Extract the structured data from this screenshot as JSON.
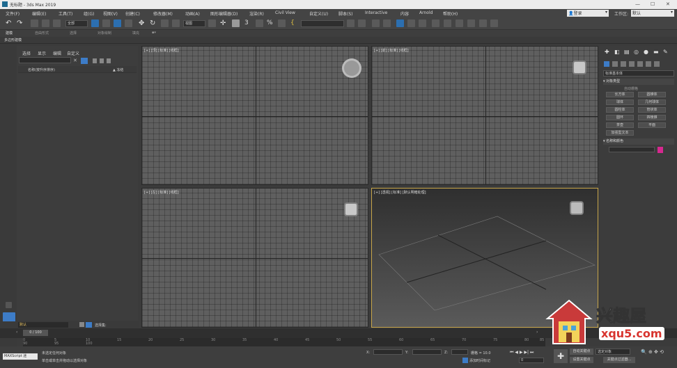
{
  "title": "无标题 - 3ds Max 2019",
  "window_controls": [
    "—",
    "☐",
    "✕"
  ],
  "menus": [
    "文件(F)",
    "编辑(E)",
    "工具(T)",
    "组(G)",
    "视图(V)",
    "创建(C)",
    "修改器(M)",
    "动画(A)",
    "图形编辑器(D)",
    "渲染(R)",
    "Civil View",
    "自定义(U)",
    "脚本(S)",
    "Interactive",
    "内容",
    "Arnold",
    "帮助(H)"
  ],
  "login": "登录",
  "workspace_label": "工作区:",
  "workspace_value": "默认",
  "toolbar": {
    "selection_filter": "全部",
    "view_coord": "视图"
  },
  "ribbon_tabs": [
    "建模",
    "自由形式",
    "选择",
    "对象绘制",
    "填充"
  ],
  "ribbon_subtag": "多边形建模",
  "scene": {
    "menus": [
      "选择",
      "显示",
      "编辑",
      "自定义"
    ],
    "column": "名称(按升序排序)",
    "column2": "▲ 冻结"
  },
  "viewports": [
    {
      "label": "[+] [顶] [标准] [线框]"
    },
    {
      "label": "[+] [前] [标准] [线框]"
    },
    {
      "label": "[+] [左] [标准] [线框]"
    },
    {
      "label": "[+] [透视] [标准] [默认明暗处理]"
    }
  ],
  "command_panel": {
    "category": "标准基本体",
    "rollout1": "对象类型",
    "autogrid": "自动栅格",
    "buttons": [
      "长方体",
      "圆锥体",
      "球体",
      "几何球体",
      "圆柱体",
      "管状体",
      "圆环",
      "四棱锥",
      "茶壶",
      "平面",
      "加强型文本"
    ],
    "rollout2": "名称和颜色",
    "color": "#d6288f"
  },
  "timeline": {
    "frame": "0 / 100",
    "ticks": [
      "0",
      "5",
      "10",
      "15",
      "20",
      "25",
      "30",
      "35",
      "40",
      "45",
      "50",
      "55",
      "60",
      "65",
      "70",
      "75",
      "80",
      "85",
      "90",
      "95",
      "100"
    ]
  },
  "layer": "默认",
  "selection_set": "选择集:",
  "status": {
    "script": "MAXScript 迷",
    "line1": "未选定任何对象",
    "line2": "单击或单击并拖动以选择对象",
    "grid": "栅格 = 10.0",
    "coord_x": "X:",
    "coord_y": "Y:",
    "coord_z": "Z:",
    "add_time_tag": "添加时间标记",
    "auto_key": "自动关键点",
    "set_key": "设置关键点",
    "selected": "选定对象",
    "key_filters": "关键点过滤器...",
    "frame": "0"
  },
  "watermark": {
    "brand": "兴趣屋",
    "site": "xqu5.com"
  }
}
